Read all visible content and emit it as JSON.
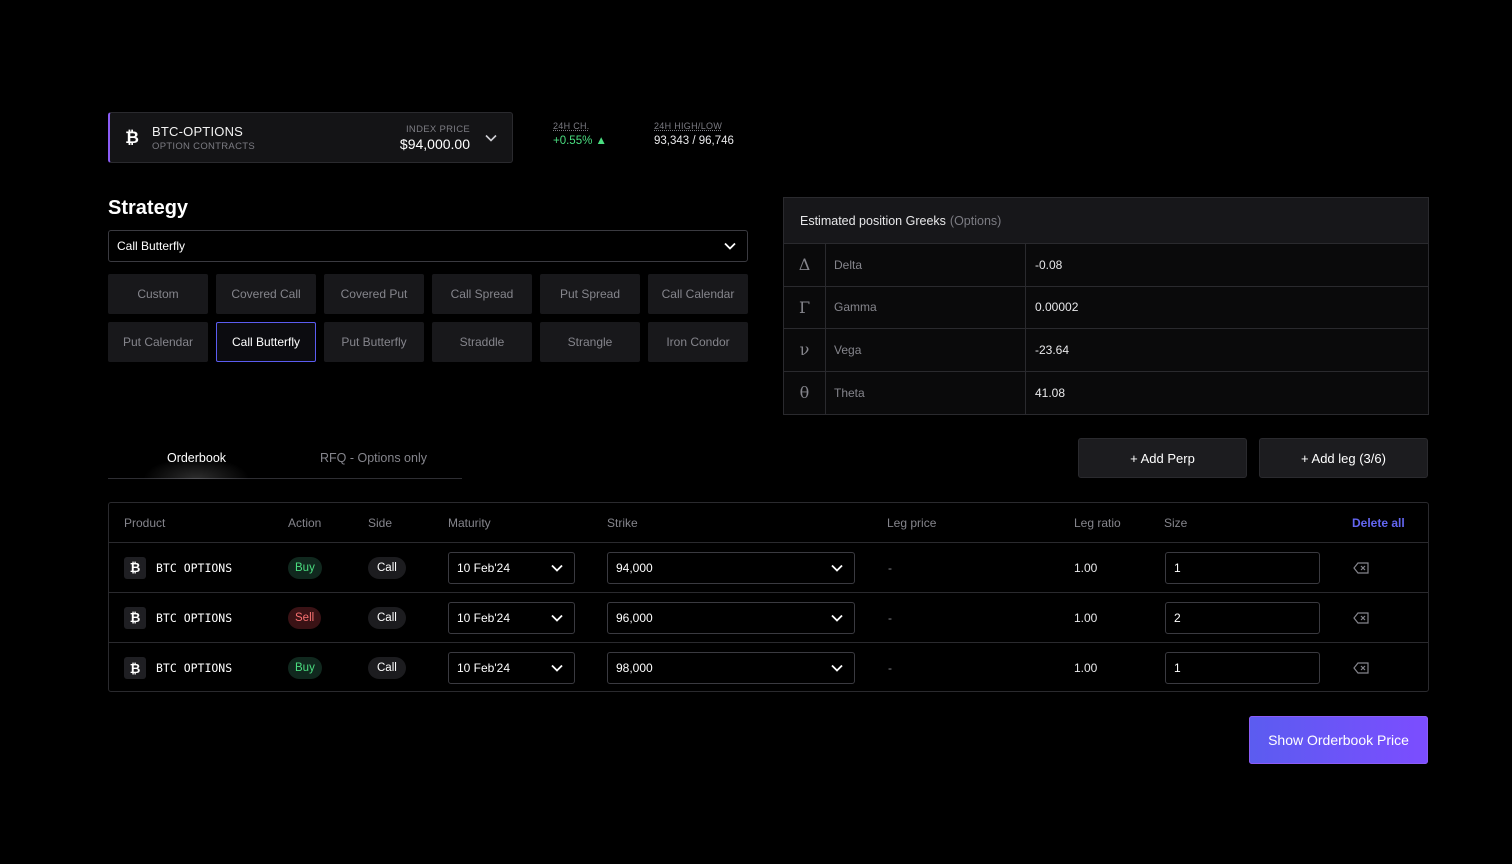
{
  "market": {
    "coin_symbol": "₿",
    "name": "BTC-OPTIONS",
    "subtitle": "OPTION CONTRACTS",
    "index_label": "INDEX PRICE",
    "index_value": "$94,000.00"
  },
  "stats": {
    "change_label": "24H CH.",
    "change_value": "+0.55% ▲",
    "highlow_label": "24H HIGH/LOW",
    "highlow_value": "93,343 / 96,746"
  },
  "strategy": {
    "title": "Strategy",
    "selected": "Call Butterfly",
    "options": [
      "Custom",
      "Covered Call",
      "Covered Put",
      "Call Spread",
      "Put Spread",
      "Call Calendar",
      "Put Calendar",
      "Call Butterfly",
      "Put Butterfly",
      "Straddle",
      "Strangle",
      "Iron Condor"
    ]
  },
  "greeks": {
    "title": "Estimated position Greeks",
    "title_suffix": "(Options)",
    "rows": [
      {
        "symbol": "Δ",
        "name": "Delta",
        "value": "-0.08"
      },
      {
        "symbol": "Γ",
        "name": "Gamma",
        "value": "0.00002"
      },
      {
        "symbol": "ν",
        "name": "Vega",
        "value": "-23.64"
      },
      {
        "symbol": "θ",
        "name": "Theta",
        "value": "41.08"
      }
    ]
  },
  "tabs": {
    "orderbook": "Orderbook",
    "rfq": "RFQ - Options only"
  },
  "actions": {
    "add_perp": "+ Add Perp",
    "add_leg": "+ Add leg (3/6)"
  },
  "legs": {
    "headers": {
      "product": "Product",
      "action": "Action",
      "side": "Side",
      "maturity": "Maturity",
      "strike": "Strike",
      "leg_price": "Leg price",
      "leg_ratio": "Leg ratio",
      "size": "Size",
      "delete_all": "Delete all"
    },
    "rows": [
      {
        "product": "BTC OPTIONS",
        "action": "Buy",
        "side": "Call",
        "maturity": "10 Feb'24",
        "strike": "94,000",
        "leg_price": "-",
        "leg_ratio": "1.00",
        "size": "1"
      },
      {
        "product": "BTC OPTIONS",
        "action": "Sell",
        "side": "Call",
        "maturity": "10 Feb'24",
        "strike": "96,000",
        "leg_price": "-",
        "leg_ratio": "1.00",
        "size": "2"
      },
      {
        "product": "BTC OPTIONS",
        "action": "Buy",
        "side": "Call",
        "maturity": "10 Feb'24",
        "strike": "98,000",
        "leg_price": "-",
        "leg_ratio": "1.00",
        "size": "1"
      }
    ]
  },
  "submit": {
    "label": "Show Orderbook Price"
  }
}
